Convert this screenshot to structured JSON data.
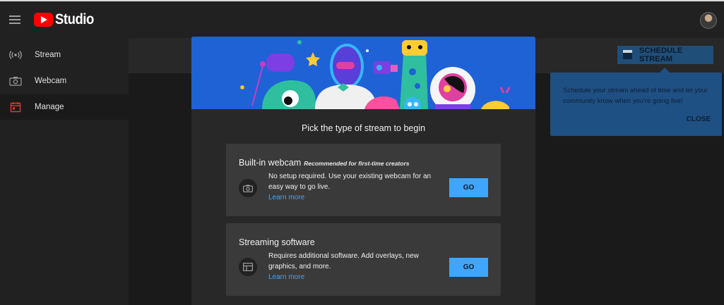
{
  "header": {
    "logo_text": "Studio"
  },
  "sidebar": {
    "items": [
      {
        "label": "Stream",
        "icon": "broadcast-icon"
      },
      {
        "label": "Webcam",
        "icon": "camera-icon"
      },
      {
        "label": "Manage",
        "icon": "calendar-icon"
      }
    ]
  },
  "schedule": {
    "button_label": "SCHEDULE STREAM",
    "tooltip_text": "Schedule your stream ahead of time and let your community know when you're going live!",
    "tooltip_close": "CLOSE"
  },
  "dialog": {
    "title": "Pick the type of stream to begin",
    "options": [
      {
        "title": "Built-in webcam",
        "recommendation": "Recommended for first-time creators",
        "description": "No setup required. Use your existing webcam for an easy way to go live.",
        "link": "Learn more",
        "button": "GO",
        "icon": "camera-icon"
      },
      {
        "title": "Streaming software",
        "recommendation": "",
        "description": "Requires additional software. Add overlays, new graphics, and more.",
        "link": "Learn more",
        "button": "GO",
        "icon": "layout-icon"
      }
    ]
  },
  "colors": {
    "accent_blue": "#3ea6ff",
    "brand_red": "#ff0000",
    "tooltip_blue": "#1f5084",
    "hero_blue": "#1e62d6"
  }
}
